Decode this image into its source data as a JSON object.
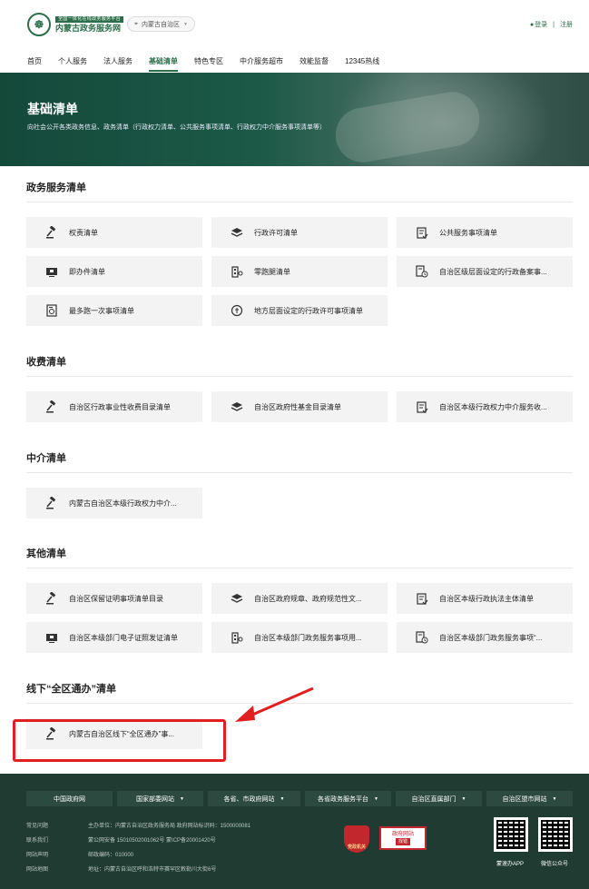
{
  "header": {
    "logo_tag": "全国一体化在线政务服务平台",
    "logo_name": "内蒙古政务服务网",
    "region": "内蒙古自治区",
    "login": "登录",
    "register": "注册"
  },
  "nav": [
    "首页",
    "个人服务",
    "法人服务",
    "基础清单",
    "特色专区",
    "中介服务超市",
    "效能监督",
    "12345热线"
  ],
  "nav_active": "基础清单",
  "banner": {
    "title": "基础清单",
    "subtitle": "向社会公开各类政务信息、政务清单（行政权力清单、公共服务事项清单、行政权力中介服务事项清单等）"
  },
  "sections": [
    {
      "title": "政务服务清单",
      "items": [
        {
          "label": "权责清单",
          "icon": "gavel-icon"
        },
        {
          "label": "行政许可清单",
          "icon": "layers-icon"
        },
        {
          "label": "公共服务事项清单",
          "icon": "checklist-icon"
        },
        {
          "label": "即办件清单",
          "icon": "monitor-icon"
        },
        {
          "label": "零跑腿清单",
          "icon": "building-icon"
        },
        {
          "label": "自治区级层面设定的行政备案事...",
          "icon": "document-clock-icon"
        },
        {
          "label": "最多跑一次事项清单",
          "icon": "refresh-doc-icon"
        },
        {
          "label": "地方层面设定的行政许可事项清单",
          "icon": "circle-arrows-icon"
        }
      ]
    },
    {
      "title": "收费清单",
      "items": [
        {
          "label": "自治区行政事业性收费目录清单",
          "icon": "gavel-icon"
        },
        {
          "label": "自治区政府性基金目录清单",
          "icon": "layers-icon"
        },
        {
          "label": "自治区本级行政权力中介服务收...",
          "icon": "checklist-icon"
        }
      ]
    },
    {
      "title": "中介清单",
      "items": [
        {
          "label": "内蒙古自治区本级行政权力中介...",
          "icon": "gavel-icon"
        }
      ]
    },
    {
      "title": "其他清单",
      "items": [
        {
          "label": "自治区保留证明事项清单目录",
          "icon": "gavel-icon"
        },
        {
          "label": "自治区政府规章、政府规范性文...",
          "icon": "layers-icon"
        },
        {
          "label": "自治区本级行政执法主体清单",
          "icon": "checklist-icon"
        },
        {
          "label": "自治区本级部门电子证照发证清单",
          "icon": "monitor-icon"
        },
        {
          "label": "自治区本级部门政务服务事项用...",
          "icon": "building-icon"
        },
        {
          "label": "自治区本级部门政务服务事项“...",
          "icon": "document-clock-icon"
        }
      ]
    },
    {
      "title": "线下“全区通办”清单",
      "items": [
        {
          "label": "内蒙古自治区线下“全区通办”事...",
          "icon": "gavel-icon"
        }
      ]
    }
  ],
  "footer": {
    "links": [
      "中国政府网",
      "国家部委网站",
      "各省、市政府网站",
      "各省政务服务平台",
      "自治区直属部门",
      "自治区盟市网站"
    ],
    "left": [
      "常见问题",
      "联系我们",
      "网站声明",
      "网站地图"
    ],
    "info": [
      "主办单位：内蒙古自治区政务服务局   政府网站标识码：1500000081",
      "蒙公网安备 15010502001062号   蒙ICP备20001420号",
      "邮政编码：010000",
      "地址：内蒙古自治区呼和浩特市赛罕区敕勒川大街6号"
    ],
    "badge1": "党政机关",
    "badge2_top": "政府网站",
    "badge2_bottom": "找错",
    "qr1_label": "蒙速办APP",
    "qr2_label": "微信公众号"
  },
  "colors": {
    "brand": "#2c6e49",
    "footer_bg": "#1f3b32",
    "highlight": "#e02020"
  }
}
